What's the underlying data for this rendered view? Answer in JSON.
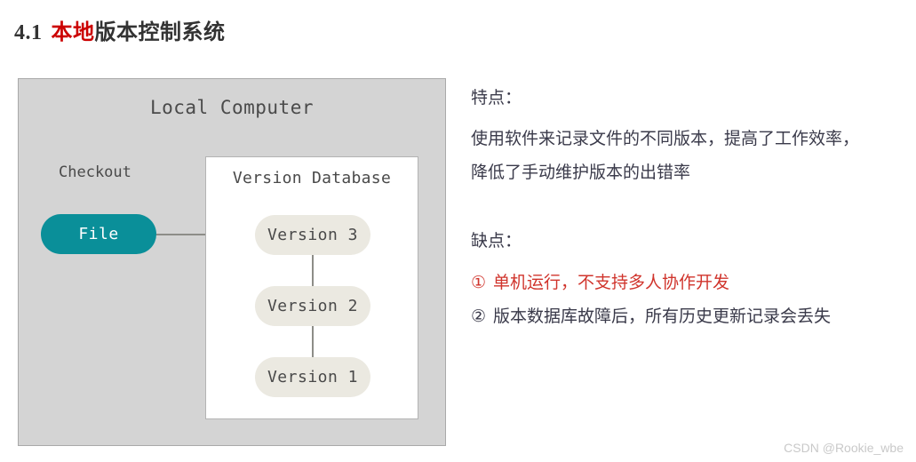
{
  "heading": {
    "number": "4.1",
    "highlight": "本地",
    "rest": "版本控制系统",
    "highlight_color": "#cc0000"
  },
  "diagram": {
    "title": "Local Computer",
    "checkout_label": "Checkout",
    "file_node": "File",
    "file_node_color": "#0a8f99",
    "panel_color": "#d4d4d4",
    "version_db": {
      "title": "Version Database",
      "node_color": "#ebe9e1",
      "nodes": [
        {
          "label": "Version 3"
        },
        {
          "label": "Version 2"
        },
        {
          "label": "Version 1"
        }
      ]
    },
    "connector_color": "#8d8d88"
  },
  "notes": {
    "pros_head": "特点：",
    "pros_lines": [
      "使用软件来记录文件的不同版本，提高了工作效率，",
      "降低了手动维护版本的出错率"
    ],
    "cons_head": "缺点：",
    "cons_items": [
      {
        "marker": "①",
        "text": "单机运行，不支持多人协作开发",
        "color": "#d0342c"
      },
      {
        "marker": "②",
        "text": "版本数据库故障后，所有历史更新记录会丢失",
        "color": "#3a3a4a"
      }
    ]
  },
  "watermark": "CSDN @Rookie_wbe"
}
